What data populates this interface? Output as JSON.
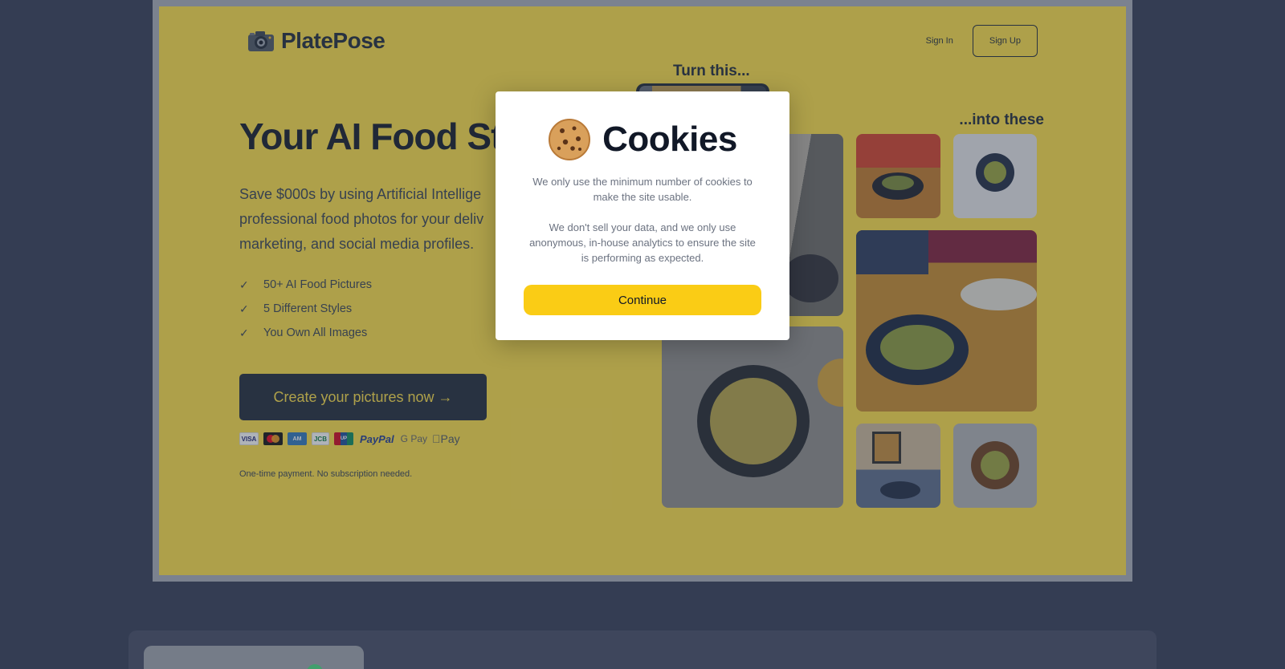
{
  "header": {
    "logo_text": "PlatePose",
    "sign_in": "Sign In",
    "sign_up": "Sign Up"
  },
  "hero": {
    "title": "Your AI Food Sty",
    "subtitle": "Save $000s by using Artificial Intellige professional food photos for your deliv marketing, and social media profiles.",
    "features": [
      "50+ AI Food Pictures",
      "5 Different Styles",
      "You Own All Images"
    ],
    "cta": "Create your pictures now →",
    "note": "One-time payment. No subscription needed."
  },
  "payments": {
    "visa": "VISA",
    "paypal": "PayPal",
    "gpay": "G Pay",
    "applepay": "Pay"
  },
  "gallery": {
    "turn_this": "Turn this...",
    "into_these": "...into these"
  },
  "modal": {
    "title": "Cookies",
    "text1": "We only use the minimum number of cookies to make the site usable.",
    "text2": "We don't sell your data, and we only use anonymous, in-house analytics to ensure the site is performing as expected.",
    "button": "Continue"
  },
  "colors": {
    "brand_yellow": "#fde047",
    "dark": "#1f2937",
    "button_yellow": "#facc15",
    "background": "#323b55"
  },
  "icons": [
    "camera-icon",
    "check-icon",
    "cookie-icon",
    "arrow-right-icon"
  ]
}
